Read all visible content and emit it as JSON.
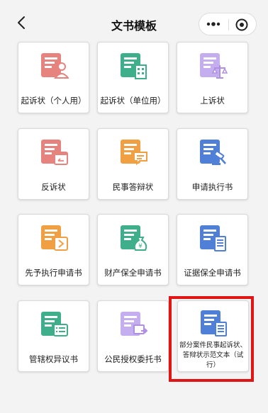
{
  "header": {
    "title": "文书模板",
    "more_icon": "more-dots-icon",
    "close_icon": "target-circle-icon"
  },
  "cards": [
    {
      "label": "起诉状（个人用）",
      "icon": "complaint-personal-icon",
      "color": "#e6837e"
    },
    {
      "label": "起诉状（单位用）",
      "icon": "complaint-company-icon",
      "color": "#3fae8a"
    },
    {
      "label": "上诉状",
      "icon": "appeal-scales-icon",
      "color": "#ae8fe0"
    },
    {
      "label": "反诉状",
      "icon": "counterclaim-calendar-icon",
      "color": "#e6837e"
    },
    {
      "label": "民事答辩状",
      "icon": "civil-defense-chat-icon",
      "color": "#f0a042"
    },
    {
      "label": "申请执行书",
      "icon": "execution-gavel-icon",
      "color": "#4f7fd6"
    },
    {
      "label": "先予执行申请书",
      "icon": "advance-execution-icon",
      "color": "#f0a042"
    },
    {
      "label": "财产保全申请书",
      "icon": "property-preservation-icon",
      "color": "#3fae8a"
    },
    {
      "label": "证据保全申请书",
      "icon": "evidence-preservation-icon",
      "color": "#4f7fd6"
    },
    {
      "label": "管辖权异议书",
      "icon": "jurisdiction-objection-icon",
      "color": "#3fae8a"
    },
    {
      "label": "公民授权委托书",
      "icon": "power-of-attorney-icon",
      "color": "#ae8fe0"
    },
    {
      "label": "部分案件民事起诉状、答辩状示范文本（试行）",
      "icon": "sample-text-icon",
      "color": "#4f7fd6"
    }
  ],
  "highlight_color": "#e01515"
}
